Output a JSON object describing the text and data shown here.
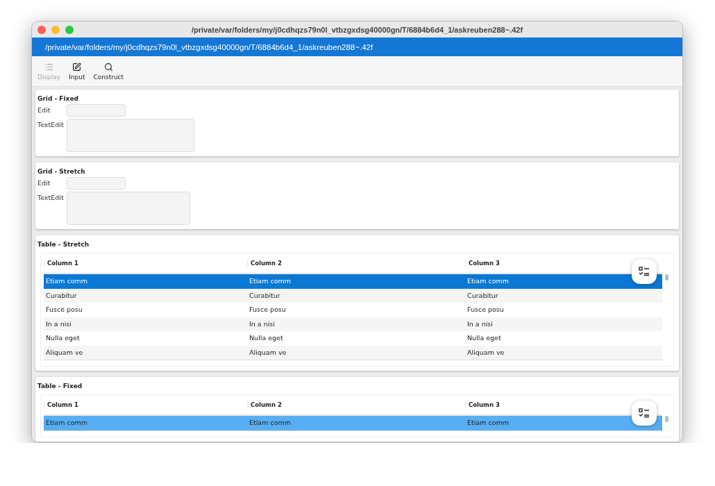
{
  "window": {
    "title": "/private/var/folders/my/j0cdhqzs79n0l_vtbzgxdsg40000gn/T/6884b6d4_1/askreuben288~.42f"
  },
  "path_bar": "/private/var/folders/my/j0cdhqzs79n0l_vtbzgxdsg40000gn/T/6884b6d4_1/askreuben288~.42f",
  "toolbar": [
    {
      "kind": "list",
      "label": "Display",
      "disabled": true
    },
    {
      "kind": "edit",
      "label": "Input",
      "disabled": false
    },
    {
      "kind": "search",
      "label": "Construct",
      "disabled": false
    }
  ],
  "sections": [
    {
      "kind": "grid",
      "title": "Grid - Fixed",
      "fields": [
        {
          "kind": "line",
          "label": "Edit"
        },
        {
          "kind": "area",
          "label": "TextEdit"
        }
      ],
      "area_wide": true
    },
    {
      "kind": "grid",
      "title": "Grid - Stretch",
      "fields": [
        {
          "kind": "line",
          "label": "Edit"
        },
        {
          "kind": "area",
          "label": "TextEdit"
        }
      ],
      "area_wide": false
    },
    {
      "kind": "table",
      "title": "Table - Stretch",
      "focused": true,
      "columns": [
        "Column 1",
        "Column 2",
        "Column 3"
      ],
      "rows": [
        {
          "cells": [
            "Etiam comm",
            "Etiam comm",
            "Etiam comm"
          ],
          "selected": true
        },
        {
          "cells": [
            "Curabitur",
            "Curabitur",
            "Curabitur"
          ],
          "selected": false
        },
        {
          "cells": [
            "Fusce posu",
            "Fusce posu",
            "Fusce posu"
          ],
          "selected": false
        },
        {
          "cells": [
            "In a nisi",
            "In a nisi",
            "In a nisi"
          ],
          "selected": false
        },
        {
          "cells": [
            "Nulla eget",
            "Nulla eget",
            "Nulla eget"
          ],
          "selected": false
        },
        {
          "cells": [
            "Aliquam ve",
            "Aliquam ve",
            "Aliquam ve"
          ],
          "selected": false
        }
      ]
    },
    {
      "kind": "table",
      "title": "Table - Fixed",
      "focused": false,
      "columns": [
        "Column 1",
        "Column 2",
        "Column 3"
      ],
      "rows": [
        {
          "cells": [
            "Etiam comm",
            "Etiam comm",
            "Etiam comm"
          ],
          "selected": true
        }
      ]
    }
  ]
}
